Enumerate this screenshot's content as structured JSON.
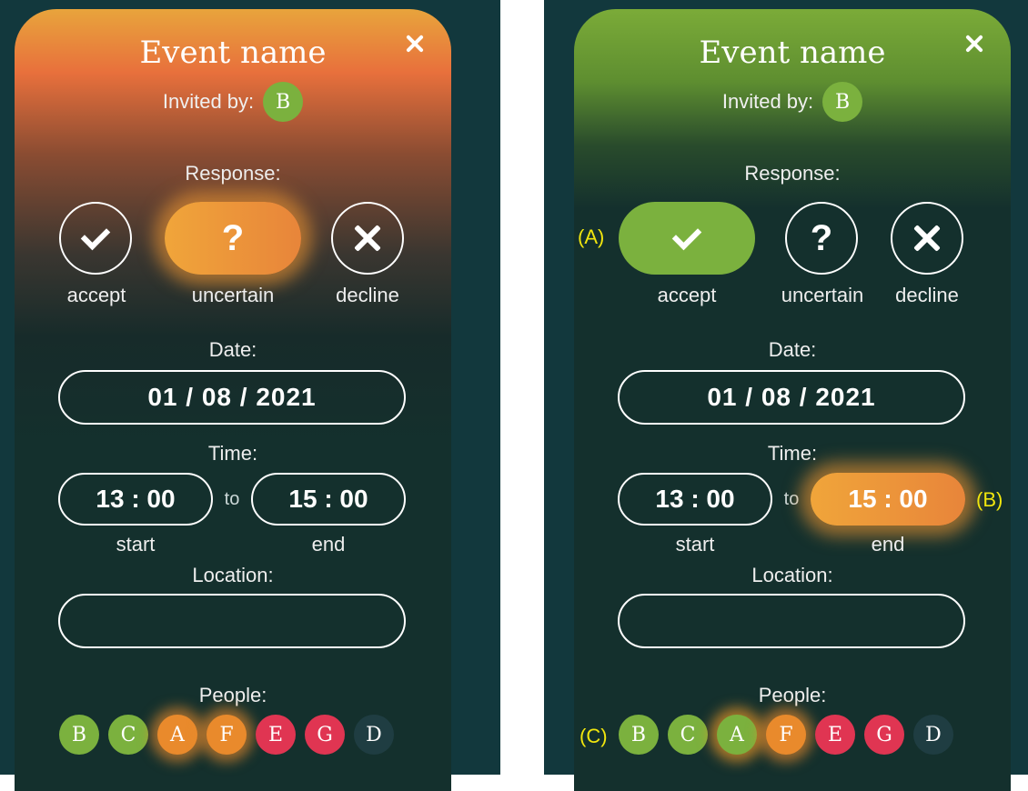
{
  "left_card": {
    "title": "Event name",
    "invited_label": "Invited by:",
    "inviter": "B",
    "response_label": "Response:",
    "responses": [
      {
        "icon": "check-icon",
        "caption": "accept"
      },
      {
        "icon": "question-icon",
        "caption": "uncertain",
        "glyph": "?"
      },
      {
        "icon": "close-x-icon",
        "caption": "decline"
      }
    ],
    "date_label": "Date:",
    "date_value": "01 / 08 / 2021",
    "time_label": "Time:",
    "start_time": "13 : 00",
    "to_label": "to",
    "end_time": "15 : 00",
    "start_caption": "start",
    "end_caption": "end",
    "location_label": "Location:",
    "location_value": "",
    "people_label": "People:",
    "people": [
      "B",
      "C",
      "A",
      "F",
      "E",
      "G",
      "D"
    ]
  },
  "right_card": {
    "title": "Event name",
    "invited_label": "Invited by:",
    "inviter": "B",
    "response_label": "Response:",
    "responses": [
      {
        "icon": "check-icon",
        "caption": "accept"
      },
      {
        "icon": "question-icon",
        "caption": "uncertain",
        "glyph": "?"
      },
      {
        "icon": "close-x-icon",
        "caption": "decline"
      }
    ],
    "date_label": "Date:",
    "date_value": "01 / 08 / 2021",
    "time_label": "Time:",
    "start_time": "13 : 00",
    "to_label": "to",
    "end_time": "15 : 00",
    "start_caption": "start",
    "end_caption": "end",
    "location_label": "Location:",
    "location_value": "",
    "people_label": "People:",
    "people": [
      "B",
      "C",
      "A",
      "F",
      "E",
      "G",
      "D"
    ],
    "annotations": {
      "a": "(A)",
      "b": "(B)",
      "c": "(C)"
    }
  },
  "colors": {
    "accent_green": "#7bb13e",
    "accent_orange": "#e98a2c",
    "accent_red": "#e03552",
    "background": "#14302d",
    "annotation_yellow": "#f1e60e"
  }
}
